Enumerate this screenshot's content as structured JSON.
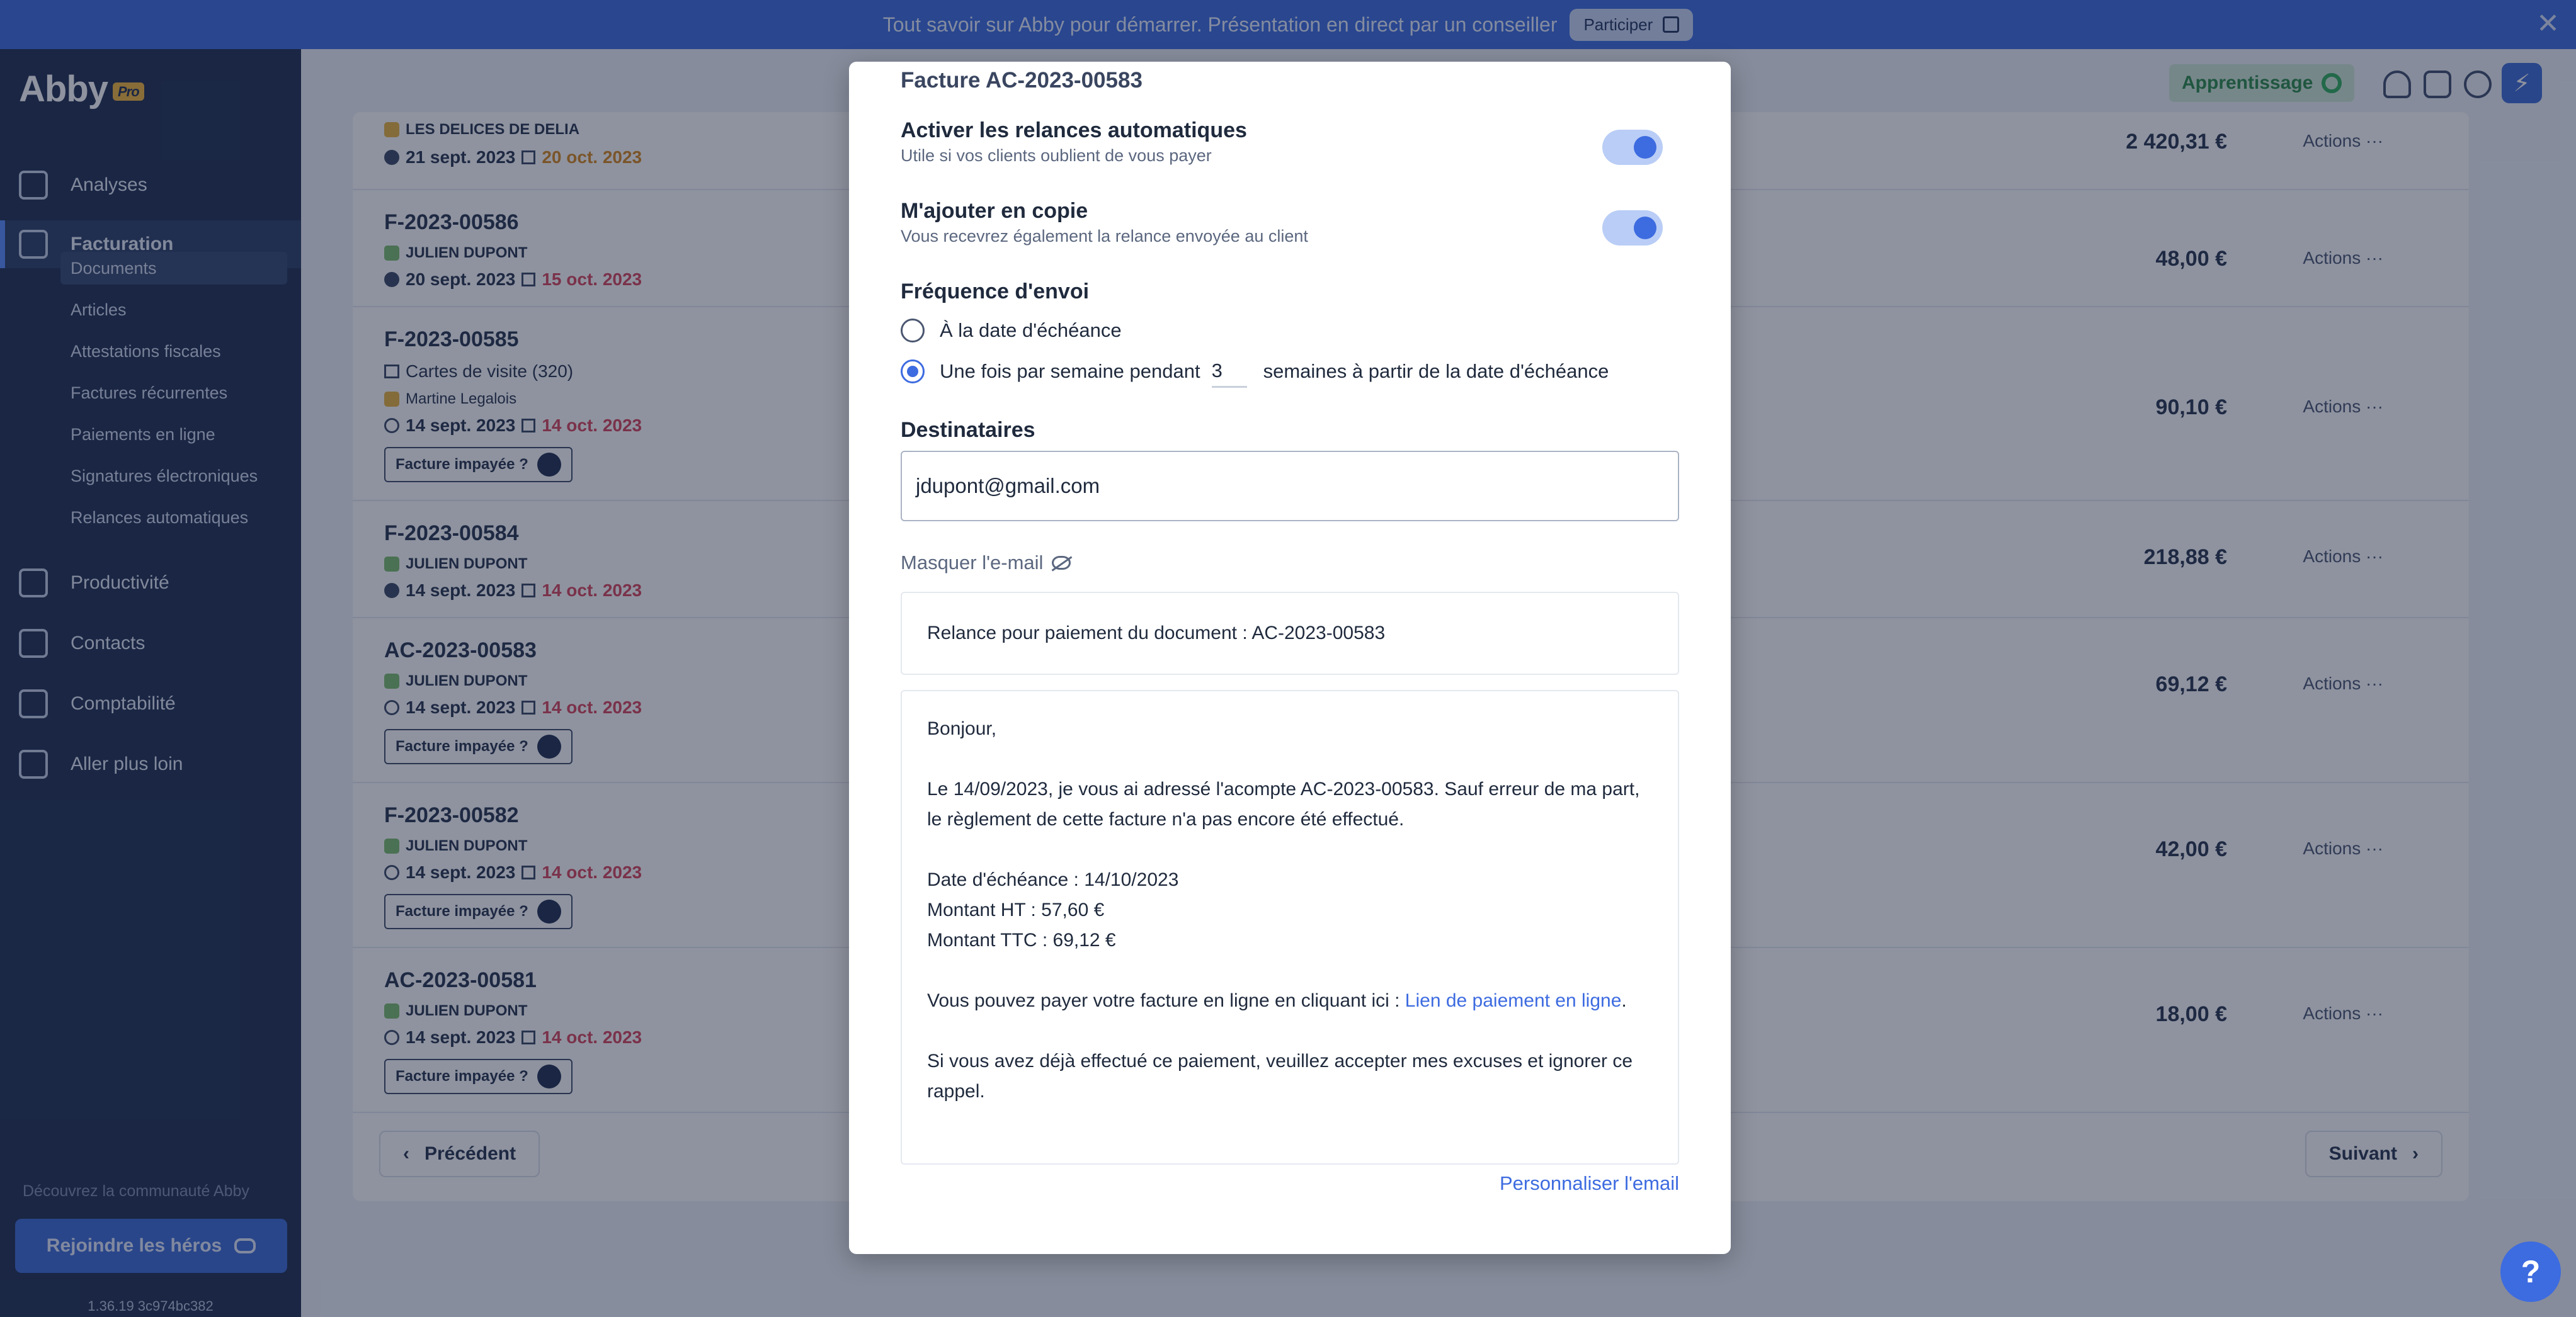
{
  "banner": {
    "text": "Tout savoir sur Abby pour démarrer. Présentation en direct par un conseiller",
    "button_label": "Participer",
    "close_glyph": "✕"
  },
  "sidebar": {
    "logo": "Abby",
    "logo_badge": "Pro",
    "nav": [
      {
        "label": "Analyses",
        "icon": "chart-icon"
      },
      {
        "label": "Facturation",
        "icon": "document-icon"
      },
      {
        "label": "Productivité",
        "icon": "grid-icon"
      },
      {
        "label": "Contacts",
        "icon": "users-icon"
      },
      {
        "label": "Comptabilité",
        "icon": "calculator-icon"
      },
      {
        "label": "Aller plus loin",
        "icon": "rocket-icon"
      }
    ],
    "sub_items": [
      "Documents",
      "Articles",
      "Attestations fiscales",
      "Factures récurrentes",
      "Paiements en ligne",
      "Signatures électroniques",
      "Relances automatiques"
    ],
    "community": "Découvrez la communauté Abby",
    "join_label": "Rejoindre les héros",
    "version": "1.36.19 3c974bc382"
  },
  "topbar": {
    "apprentissage": "Apprentissage",
    "avatar_letter": "⚡"
  },
  "documents": {
    "rows": [
      {
        "number": "",
        "client": "LES DELICES DE DELIA",
        "date": "21 sept. 2023",
        "due": "20 oct. 2023",
        "amount": "2 420,31 €",
        "unpaid": false
      },
      {
        "number": "F-2023-00586",
        "client": "JULIEN DUPONT",
        "date": "20 sept. 2023",
        "due": "15 oct. 2023",
        "amount": "48,00 €",
        "unpaid": false
      },
      {
        "number": "F-2023-00585",
        "product": "Cartes de visite (320)",
        "client": "Martine Legalois",
        "date": "14 sept. 2023",
        "due": "14 oct. 2023",
        "amount": "90,10 €",
        "unpaid": true
      },
      {
        "number": "F-2023-00584",
        "client": "JULIEN DUPONT",
        "date": "14 sept. 2023",
        "due": "14 oct. 2023",
        "amount": "218,88 €",
        "unpaid": false
      },
      {
        "number": "AC-2023-00583",
        "client": "JULIEN DUPONT",
        "date": "14 sept. 2023",
        "due": "14 oct. 2023",
        "amount": "69,12 €",
        "unpaid": true
      },
      {
        "number": "F-2023-00582",
        "client": "JULIEN DUPONT",
        "date": "14 sept. 2023",
        "due": "14 oct. 2023",
        "amount": "42,00 €",
        "unpaid": true
      },
      {
        "number": "AC-2023-00581",
        "client": "JULIEN DUPONT",
        "date": "14 sept. 2023",
        "due": "14 oct. 2023",
        "amount": "18,00 €",
        "unpaid": true
      }
    ],
    "unpaid_label": "Facture impayée ?",
    "actions_label": "Actions ···",
    "prev_label": "Précédent",
    "next_label": "Suivant"
  },
  "modal": {
    "title": "Facture AC-2023-00583",
    "auto_reminders": {
      "title": "Activer les relances automatiques",
      "subtitle": "Utile si vos clients oublient de vous payer",
      "enabled": true
    },
    "copy_me": {
      "title": "M'ajouter en copie",
      "subtitle": "Vous recevrez également la relance envoyée au client",
      "enabled": true
    },
    "frequency": {
      "title": "Fréquence d'envoi",
      "option_due": "À la date d'échéance",
      "option_weekly_prefix": "Une fois par semaine pendant",
      "weeks": "3",
      "option_weekly_suffix": "semaines à partir de la date d'échéance",
      "selected": "weekly"
    },
    "recipients": {
      "title": "Destinataires",
      "value": "jdupont@gmail.com"
    },
    "mask_label": "Masquer l'e-mail",
    "subject": "Relance pour paiement du document : AC-2023-00583",
    "body": {
      "greeting": "Bonjour,",
      "para1": "Le 14/09/2023, je vous ai adressé l'acompte AC-2023-00583. Sauf erreur de ma part, le règlement de cette facture n'a pas encore été effectué.",
      "due_line": "Date d'échéance : 14/10/2023",
      "ht_line": "Montant HT : 57,60 €",
      "ttc_line": "Montant TTC : 69,12 €",
      "pay_prefix": "Vous pouvez payer votre facture en ligne en cliquant ici : ",
      "pay_link": "Lien de paiement en ligne",
      "pay_suffix": ".",
      "para_last": "Si vous avez déjà effectué ce paiement, veuillez accepter mes excuses et ignorer ce rappel."
    },
    "customize_label": "Personnaliser l'email"
  },
  "help": "?",
  "colors": {
    "accent": "#3d6be0",
    "sidebar": "#1f2f52",
    "late": "#d6455d"
  }
}
